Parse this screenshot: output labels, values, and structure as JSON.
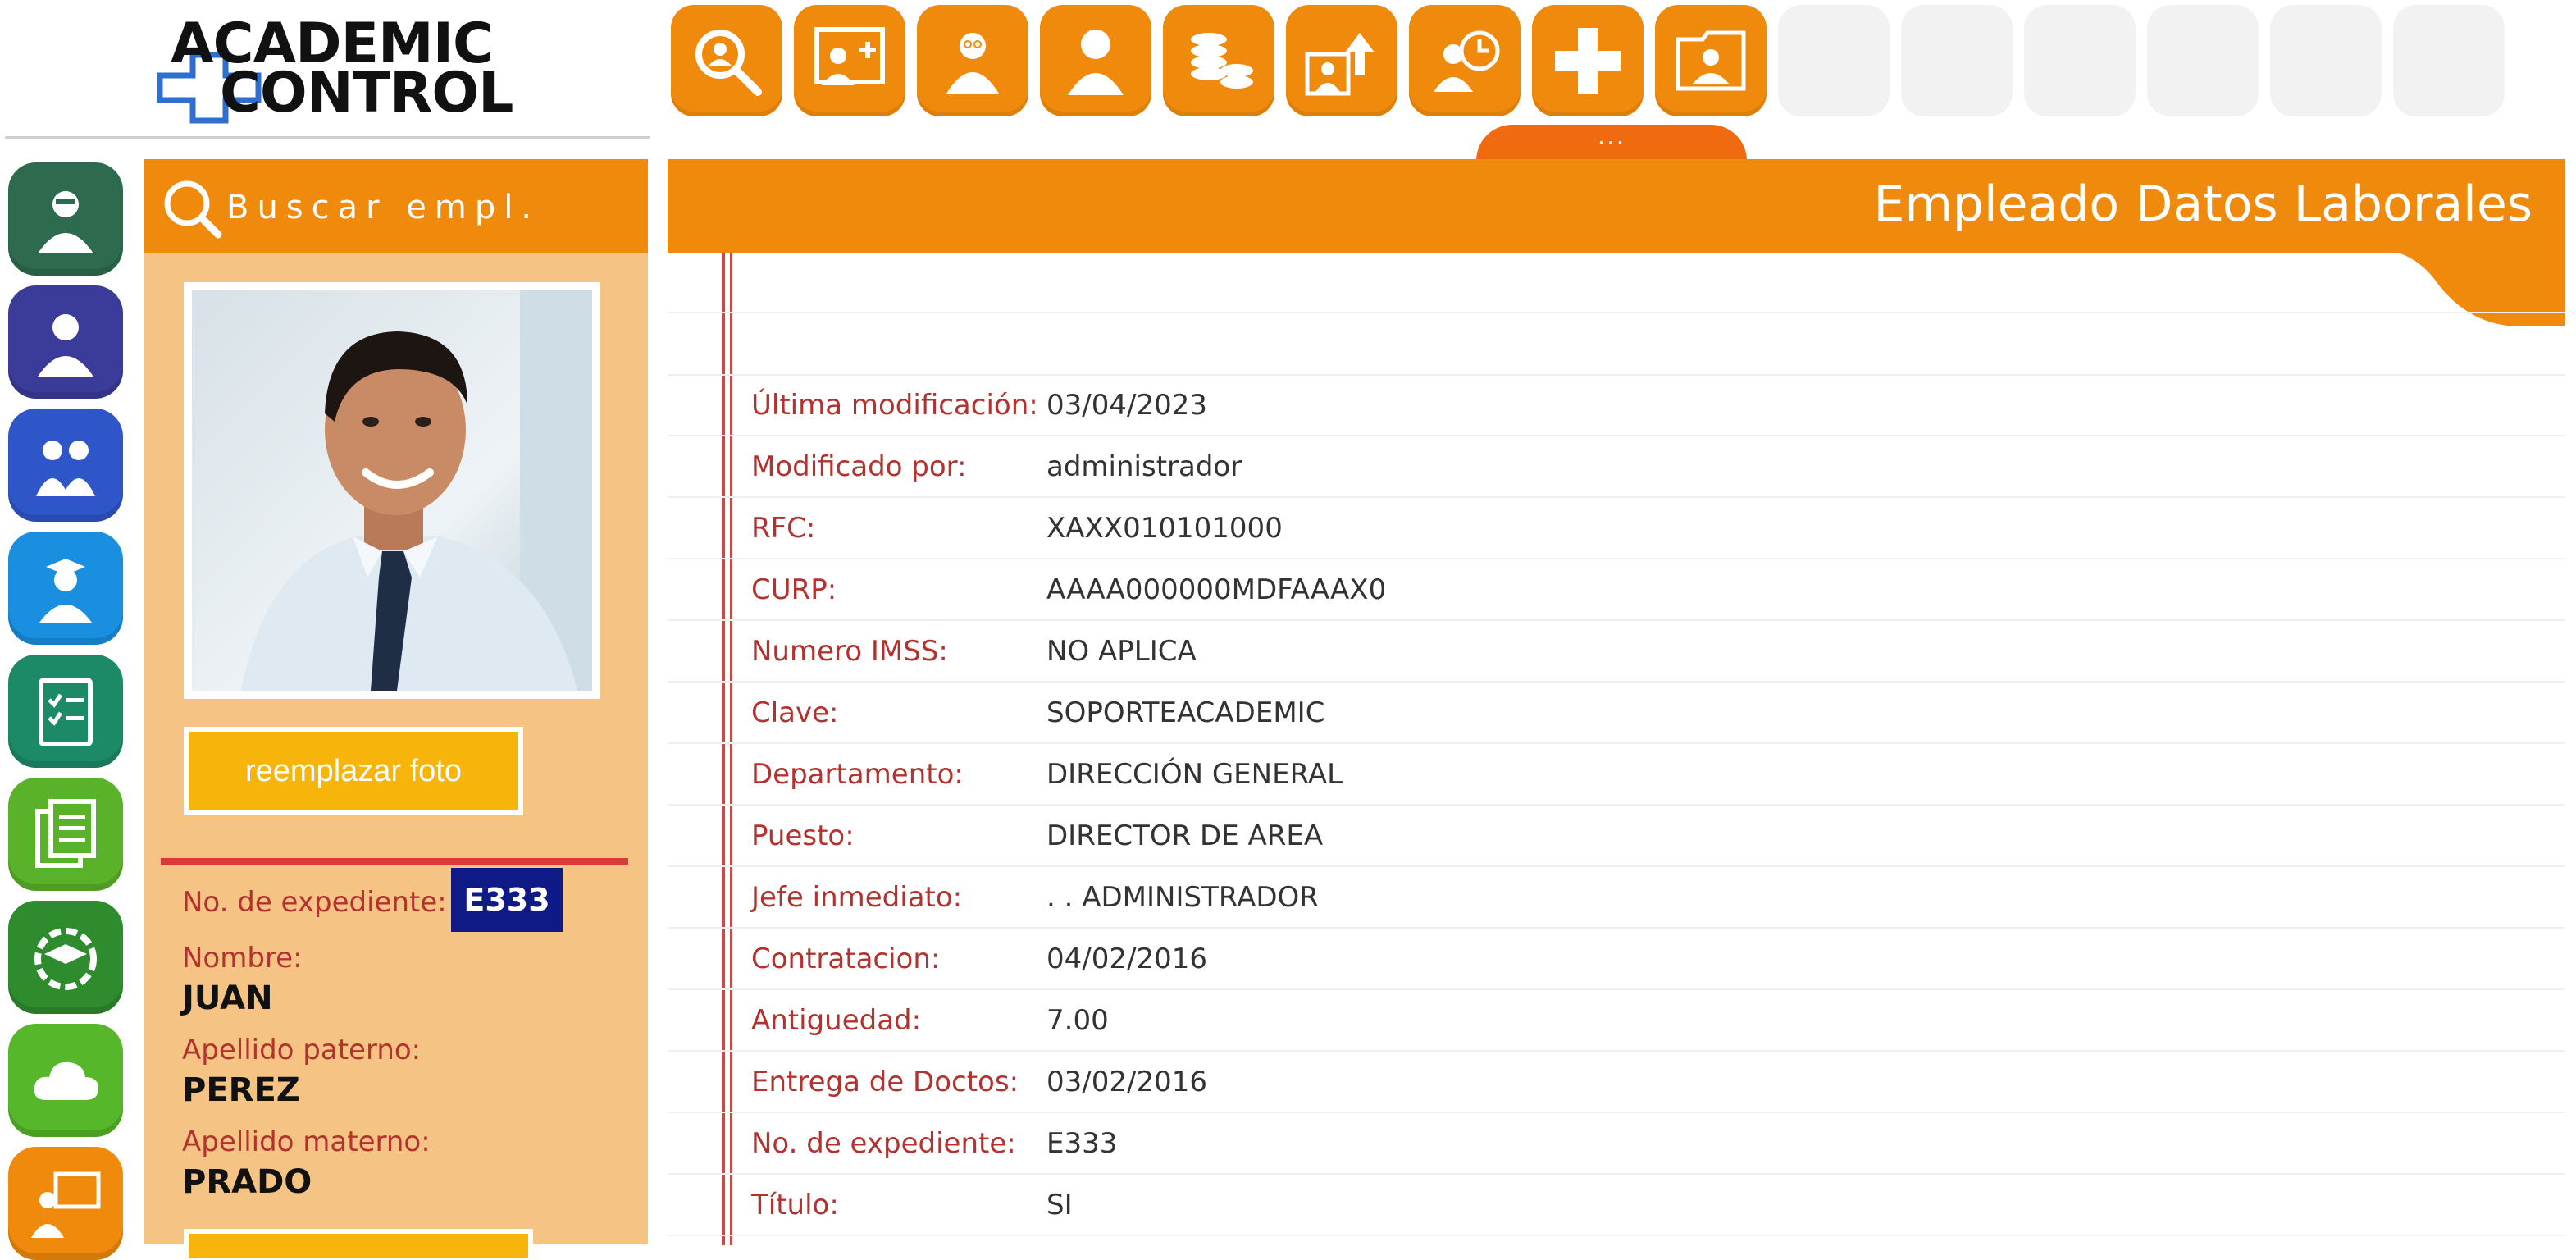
{
  "logo": {
    "line1": "ACADEMIC",
    "line2": "CONTROL"
  },
  "toolbar": {
    "buttons": [
      "search-employee-icon",
      "add-employee-icon",
      "employee-admin-icon",
      "employee-icon",
      "payroll-coins-icon",
      "upload-photo-icon",
      "attendance-clock-icon",
      "add-icon",
      "photo-album-icon"
    ],
    "more_label": "..."
  },
  "sidebar": {
    "items": [
      {
        "icon": "teacher-icon",
        "color": "#2e6b4e"
      },
      {
        "icon": "staff-icon",
        "color": "#3b3b9a"
      },
      {
        "icon": "parents-icon",
        "color": "#2f56c8"
      },
      {
        "icon": "student-icon",
        "color": "#1a8fe0"
      },
      {
        "icon": "checklist-icon",
        "color": "#1d8a67"
      },
      {
        "icon": "documents-icon",
        "color": "#5ab22b"
      },
      {
        "icon": "graduation-settings-icon",
        "color": "#2e8b2e"
      },
      {
        "icon": "cloud-icon",
        "color": "#56b72a"
      },
      {
        "icon": "presentation-icon",
        "color": "#f08a0c"
      }
    ]
  },
  "profile": {
    "search_label": "Buscar empl.",
    "replace_photo_label": "reemplazar foto",
    "expediente_label": "No. de expediente:",
    "expediente_value": "E333",
    "nombre_label": "Nombre:",
    "nombre_value": "JUAN",
    "paterno_label": "Apellido paterno:",
    "paterno_value": "PEREZ",
    "materno_label": "Apellido materno:",
    "materno_value": "PRADO"
  },
  "main": {
    "title": "Empleado Datos Laborales",
    "fields": [
      {
        "label": "Última modificación:",
        "value": "03/04/2023"
      },
      {
        "label": "Modificado por:",
        "value": "administrador"
      },
      {
        "label": "RFC:",
        "value": "XAXX010101000"
      },
      {
        "label": "CURP:",
        "value": "AAAA000000MDFAAAX0"
      },
      {
        "label": "Numero IMSS:",
        "value": "NO APLICA"
      },
      {
        "label": "Clave:",
        "value": "SOPORTEACADEMIC"
      },
      {
        "label": "Departamento:",
        "value": "DIRECCIÓN GENERAL"
      },
      {
        "label": "Puesto:",
        "value": "DIRECTOR DE AREA"
      },
      {
        "label": "Jefe inmediato:",
        "value": ". . ADMINISTRADOR"
      },
      {
        "label": "Contratacion:",
        "value": "04/02/2016"
      },
      {
        "label": "Antiguedad:",
        "value": "7.00"
      },
      {
        "label": "Entrega de Doctos:",
        "value": "03/02/2016"
      },
      {
        "label": "No. de expediente:",
        "value": "E333"
      },
      {
        "label": "Título:",
        "value": "SI"
      }
    ]
  },
  "colors": {
    "accent": "#f08a0c",
    "label_red": "#b3322f",
    "badge_navy": "#0f1a86",
    "panel_peach": "#f5c383"
  }
}
